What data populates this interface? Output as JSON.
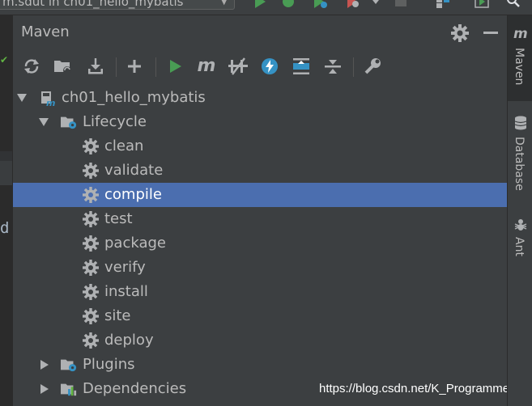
{
  "top_bar": {
    "run_config": "m.sdut in ch01_hello_mybatis"
  },
  "editor": {
    "visible_char": "d"
  },
  "panel": {
    "title": "Maven",
    "toolbar_icons": [
      "reload-icon",
      "generate-sources-icon",
      "download-icon",
      "add-icon",
      "run-icon",
      "execute-goal-icon",
      "toggle-offline-icon",
      "skip-tests-icon",
      "show-dependencies-icon",
      "expand-all-icon",
      "collapse-all-icon",
      "settings-wrench-icon"
    ]
  },
  "tree": {
    "project": "ch01_hello_mybatis",
    "lifecycle": "Lifecycle",
    "goals": [
      "clean",
      "validate",
      "compile",
      "test",
      "package",
      "verify",
      "install",
      "site",
      "deploy"
    ],
    "selected_goal": "compile",
    "plugins": "Plugins",
    "dependencies": "Dependencies"
  },
  "right_tabs": [
    {
      "label": "Maven",
      "icon": "maven-icon",
      "active": true
    },
    {
      "label": "Database",
      "icon": "database-icon",
      "active": false
    },
    {
      "label": "Ant",
      "icon": "ant-icon",
      "active": false
    }
  ],
  "watermark": "https://blog.csdn.net/K_Programmer",
  "colors": {
    "selection": "#4b6eaf",
    "run_green": "#499c54",
    "accent_blue": "#3592c4",
    "panel_bg": "#3c3f41"
  }
}
